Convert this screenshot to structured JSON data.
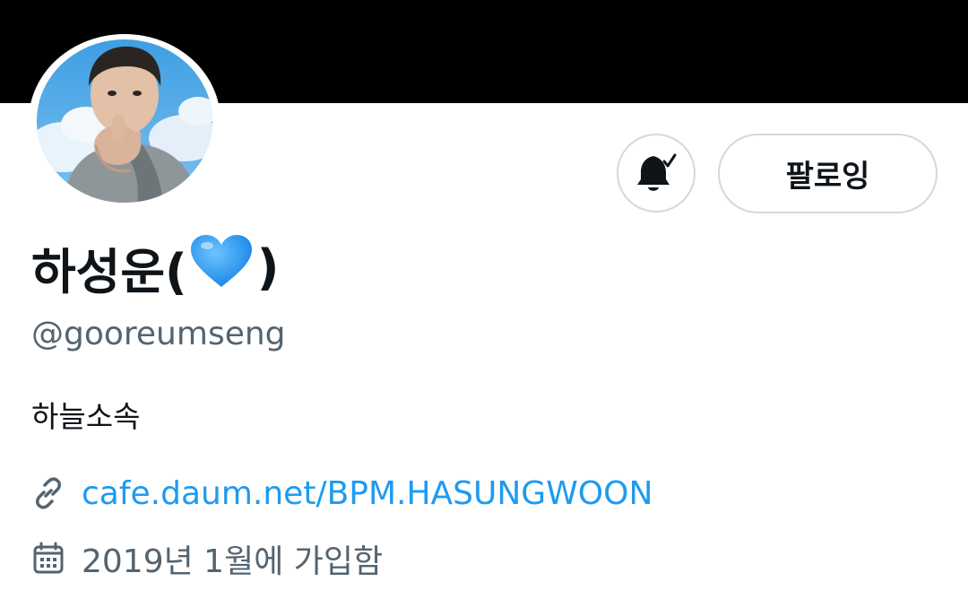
{
  "profile": {
    "name": "하성운(",
    "name_close": ")",
    "heart_icon": "blue-heart-emoji",
    "handle": "@gooreumseng",
    "bio": "하늘소속",
    "link": "cafe.daum.net/BPM.HASUNGWOON",
    "joined": "2019년 1월에 가입함"
  },
  "actions": {
    "notifications_icon": "bell-check-icon",
    "follow_label": "팔로잉"
  },
  "colors": {
    "banner": "#000000",
    "link": "#1d9bf0",
    "secondary_text": "#536471",
    "button_border": "#cfd9de",
    "heart": "#2b9cf2"
  }
}
